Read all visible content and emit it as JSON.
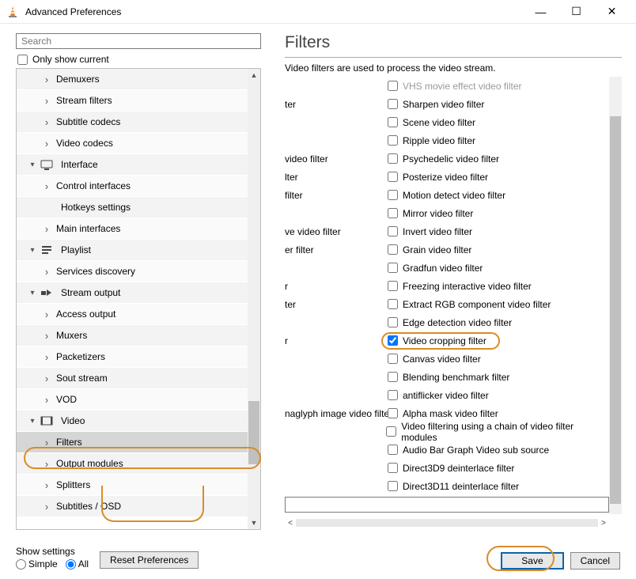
{
  "window": {
    "title": "Advanced Preferences"
  },
  "search": {
    "placeholder": "Search"
  },
  "only_current": "Only show current",
  "tree": [
    {
      "type": "child",
      "label": "Demuxers"
    },
    {
      "type": "child",
      "label": "Stream filters"
    },
    {
      "type": "child",
      "label": "Subtitle codecs"
    },
    {
      "type": "child",
      "label": "Video codecs"
    },
    {
      "type": "cat",
      "label": "Interface",
      "icon": "interface"
    },
    {
      "type": "child",
      "label": "Control interfaces"
    },
    {
      "type": "child-noexpand",
      "label": "Hotkeys settings"
    },
    {
      "type": "child",
      "label": "Main interfaces"
    },
    {
      "type": "cat",
      "label": "Playlist",
      "icon": "playlist"
    },
    {
      "type": "child",
      "label": "Services discovery"
    },
    {
      "type": "cat",
      "label": "Stream output",
      "icon": "stream"
    },
    {
      "type": "child",
      "label": "Access output"
    },
    {
      "type": "child",
      "label": "Muxers"
    },
    {
      "type": "child",
      "label": "Packetizers"
    },
    {
      "type": "child",
      "label": "Sout stream"
    },
    {
      "type": "child",
      "label": "VOD"
    },
    {
      "type": "cat",
      "label": "Video",
      "icon": "video"
    },
    {
      "type": "child-selected",
      "label": "Filters"
    },
    {
      "type": "child",
      "label": "Output modules"
    },
    {
      "type": "child",
      "label": "Splitters"
    },
    {
      "type": "child",
      "label": "Subtitles / OSD"
    }
  ],
  "right": {
    "title": "Filters",
    "desc": "Video filters are used to process the video stream.",
    "rows": [
      {
        "left": "",
        "label": "VHS movie effect video filter",
        "checked": false,
        "dim": true
      },
      {
        "left": "ter",
        "label": "Sharpen video filter",
        "checked": false
      },
      {
        "left": "",
        "label": "Scene video filter",
        "checked": false
      },
      {
        "left": "",
        "label": "Ripple video filter",
        "checked": false
      },
      {
        "left": " video filter",
        "label": "Psychedelic video filter",
        "checked": false
      },
      {
        "left": "lter",
        "label": "Posterize video filter",
        "checked": false
      },
      {
        "left": "filter",
        "label": "Motion detect video filter",
        "checked": false
      },
      {
        "left": "",
        "label": "Mirror video filter",
        "checked": false
      },
      {
        "left": "ve video filter",
        "label": "Invert video filter",
        "checked": false
      },
      {
        "left": "er filter",
        "label": "Grain video filter",
        "checked": false
      },
      {
        "left": "",
        "label": "Gradfun video filter",
        "checked": false
      },
      {
        "left": "r",
        "label": "Freezing interactive video filter",
        "checked": false
      },
      {
        "left": "ter",
        "label": "Extract RGB component video filter",
        "checked": false
      },
      {
        "left": "",
        "label": "Edge detection video filter",
        "checked": false
      },
      {
        "left": "r",
        "label": "Video cropping filter",
        "checked": true,
        "hl": true
      },
      {
        "left": "",
        "label": "Canvas video filter",
        "checked": false
      },
      {
        "left": "",
        "label": "Blending benchmark filter",
        "checked": false
      },
      {
        "left": "",
        "label": "antiflicker video filter",
        "checked": false
      },
      {
        "left": "naglyph image video filter",
        "label": "Alpha mask video filter",
        "checked": false
      },
      {
        "left": "",
        "label": "Video filtering using a chain of video filter modules",
        "checked": false
      },
      {
        "left": "",
        "label": "Audio Bar Graph Video sub source",
        "checked": false
      },
      {
        "left": "",
        "label": "Direct3D9 deinterlace filter",
        "checked": false
      },
      {
        "left": "",
        "label": "Direct3D11 deinterlace filter",
        "checked": false
      }
    ]
  },
  "bottom": {
    "show_label": "Show settings",
    "simple": "Simple",
    "all": "All",
    "reset": "Reset Preferences",
    "save": "Save",
    "cancel": "Cancel"
  }
}
